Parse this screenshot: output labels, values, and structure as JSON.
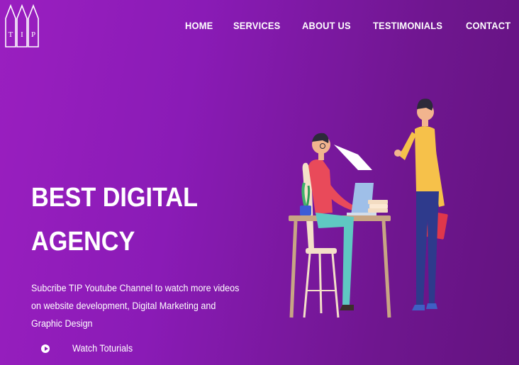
{
  "logo": {
    "letters": [
      "T",
      "I",
      "P"
    ]
  },
  "nav": {
    "items": [
      {
        "label": "HOME"
      },
      {
        "label": "SERVICES"
      },
      {
        "label": "ABOUT US"
      },
      {
        "label": "TESTIMONIALS"
      },
      {
        "label": "CONTACT"
      }
    ]
  },
  "hero": {
    "title_line1": "BEST DIGITAL",
    "title_line2": "AGENCY",
    "description": "Subcribe TIP Youtube Channel to watch more videos on website development, Digital Marketing and Graphic Design",
    "cta_label": "Watch Toturials",
    "cta_icon": "play-circle-icon"
  },
  "colors": {
    "background_start": "#9a1fc0",
    "background_end": "#63137f",
    "text": "#ffffff"
  }
}
